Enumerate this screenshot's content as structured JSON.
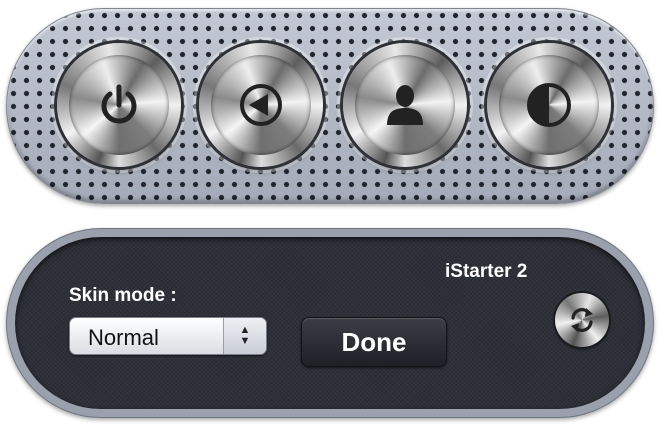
{
  "top_panel": {
    "buttons": [
      {
        "icon": "power-icon"
      },
      {
        "icon": "back-arrow-icon"
      },
      {
        "icon": "user-icon"
      },
      {
        "icon": "half-circle-icon"
      }
    ]
  },
  "settings": {
    "app_name": "iStarter 2",
    "skin_label": "Skin mode :",
    "skin_value": "Normal",
    "done_label": "Done",
    "refresh_icon": "refresh-icon"
  },
  "colors": {
    "panel_light": "#b4bac6",
    "panel_dark": "#2d3038",
    "text_light": "#ffffff"
  }
}
